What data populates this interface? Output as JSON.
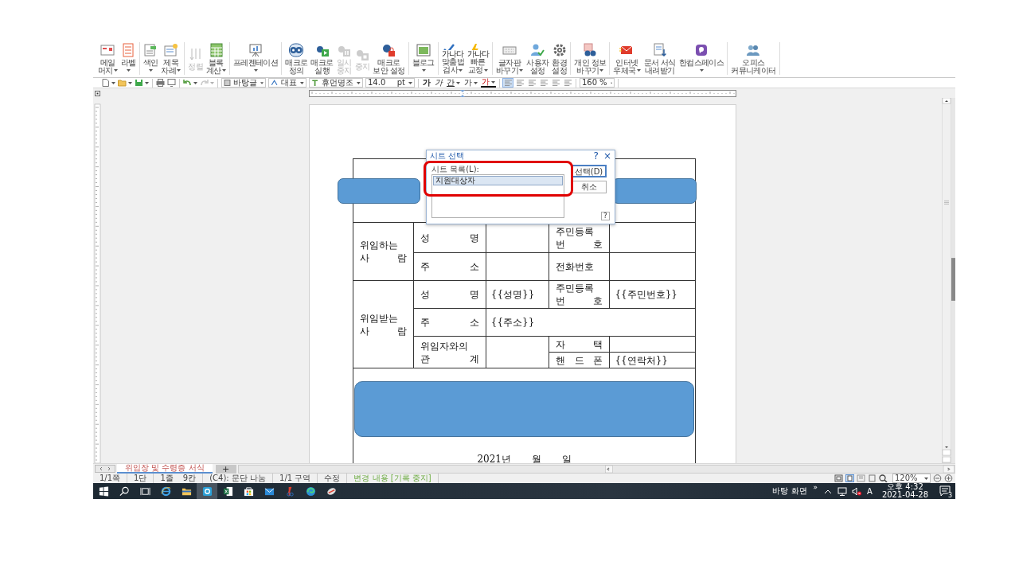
{
  "ribbon": {
    "groups": [
      {
        "buttons": [
          {
            "label": [
              "메일",
              "머지"
            ],
            "dropdown": true,
            "disabled": false
          },
          {
            "label": [
              "라벨"
            ],
            "dropdown": true,
            "disabled": false
          }
        ]
      },
      {
        "buttons": [
          {
            "label": [
              "색인"
            ],
            "dropdown": true,
            "disabled": false
          },
          {
            "label": [
              "제목",
              "차례"
            ],
            "dropdown": true,
            "disabled": false
          }
        ]
      },
      {
        "buttons": [
          {
            "label": [
              "정렬"
            ],
            "dropdown": false,
            "disabled": true
          },
          {
            "label": [
              "블록",
              "계산"
            ],
            "dropdown": true,
            "disabled": false
          }
        ]
      },
      {
        "buttons": [
          {
            "label": [
              "프레젠테이션"
            ],
            "dropdown": true,
            "disabled": false
          }
        ]
      },
      {
        "buttons": [
          {
            "label": [
              "매크로",
              "정의"
            ],
            "dropdown": false,
            "disabled": false
          },
          {
            "label": [
              "매크로",
              "실행"
            ],
            "dropdown": false,
            "disabled": false
          },
          {
            "label": [
              "일시",
              "중지"
            ],
            "dropdown": false,
            "disabled": true
          },
          {
            "label": [
              "중지"
            ],
            "dropdown": false,
            "disabled": true
          },
          {
            "label": [
              "매크로",
              "보안 설정"
            ],
            "dropdown": false,
            "disabled": false
          }
        ]
      },
      {
        "buttons": [
          {
            "label": [
              "블로그"
            ],
            "dropdown": true,
            "disabled": false
          }
        ]
      },
      {
        "buttons": [
          {
            "icon_text": "가나다",
            "label": [
              "맞춤법",
              "검사"
            ],
            "dropdown": true,
            "disabled": false
          },
          {
            "icon_text": "가나다",
            "label": [
              "빠른",
              "교정"
            ],
            "dropdown": true,
            "disabled": false
          }
        ]
      },
      {
        "buttons": [
          {
            "label": [
              "글자판",
              "바꾸기"
            ],
            "dropdown": true,
            "disabled": false
          },
          {
            "label": [
              "사용자",
              "설정"
            ],
            "dropdown": false,
            "disabled": false
          },
          {
            "label": [
              "환경",
              "설정"
            ],
            "dropdown": false,
            "disabled": false
          }
        ]
      },
      {
        "buttons": [
          {
            "label": [
              "개인 정보",
              "바꾸기"
            ],
            "dropdown": true,
            "disabled": false
          }
        ]
      },
      {
        "buttons": [
          {
            "label": [
              "인터넷",
              "우체국"
            ],
            "dropdown": true,
            "disabled": false
          },
          {
            "label": [
              "문서 서식",
              "내려받기"
            ],
            "dropdown": false,
            "disabled": false
          },
          {
            "label": [
              "한컴스페이스"
            ],
            "dropdown": true,
            "disabled": false
          }
        ]
      },
      {
        "buttons": [
          {
            "label": [
              "오피스",
              "커뮤니케이터"
            ],
            "dropdown": false,
            "disabled": false
          }
        ]
      }
    ]
  },
  "toolbar": {
    "groups": [
      [
        {
          "kind": "icon",
          "dropdown": true,
          "disabled": false
        },
        {
          "kind": "icon",
          "dropdown": true,
          "disabled": false
        },
        {
          "kind": "icon",
          "dropdown": true,
          "disabled": false
        }
      ],
      [
        {
          "kind": "icon",
          "dropdown": false,
          "disabled": false
        },
        {
          "kind": "icon",
          "dropdown": false,
          "disabled": false
        }
      ],
      [
        {
          "kind": "icon",
          "dropdown": true,
          "disabled": false
        },
        {
          "kind": "icon",
          "dropdown": true,
          "disabled": true
        }
      ],
      [
        {
          "kind": "combo",
          "value": "바탕글"
        },
        {
          "kind": "combo",
          "value": "대표"
        },
        {
          "kind": "combo",
          "value": "휴먼명조"
        },
        {
          "kind": "spin",
          "value": "14.0",
          "unit": "pt"
        }
      ],
      [
        {
          "kind": "char",
          "text": "가",
          "dropdown": false
        },
        {
          "kind": "char",
          "text": "가",
          "dropdown": false
        },
        {
          "kind": "char",
          "text": "간",
          "dropdown": true
        },
        {
          "kind": "char",
          "text": "가",
          "dropdown": true
        },
        {
          "kind": "char",
          "text": "가",
          "dropdown": true
        }
      ],
      [
        {
          "kind": "align",
          "selected": true
        },
        {
          "kind": "align",
          "selected": false
        },
        {
          "kind": "align",
          "selected": false
        },
        {
          "kind": "align",
          "selected": false
        },
        {
          "kind": "align",
          "selected": false
        },
        {
          "kind": "align",
          "selected": false
        }
      ],
      [
        {
          "kind": "spin",
          "value": "160",
          "unit": "%"
        }
      ]
    ]
  },
  "document": {
    "table": {
      "rows": [
        [
          {
            "colspan": 5
          }
        ],
        [
          {
            "rowspan": 2,
            "kind": "label",
            "lines": [
              "위임하는",
              "사 람"
            ]
          },
          {
            "kind": "label",
            "lines": [
              "성 명"
            ]
          },
          {},
          {
            "kind": "label",
            "lines": [
              "주민등록",
              "번 호"
            ]
          },
          {}
        ],
        [
          {
            "kind": "label",
            "lines": [
              "주 소"
            ]
          },
          {},
          {
            "kind": "label",
            "lines": [
              "전화번호"
            ]
          },
          {}
        ],
        [
          {
            "rowspan": 4,
            "kind": "label",
            "lines": [
              "위임받는",
              "사 람"
            ]
          },
          {
            "kind": "label",
            "lines": [
              "성 명"
            ]
          },
          {
            "kind": "value",
            "lines": [
              "{{성명}}"
            ]
          },
          {
            "kind": "label",
            "lines": [
              "주민등록",
              "번 호"
            ]
          },
          {
            "kind": "value",
            "lines": [
              "{{주민번호}}"
            ]
          }
        ],
        [
          {
            "kind": "label",
            "lines": [
              "주 소"
            ]
          },
          {
            "colspan": 3,
            "kind": "value",
            "lines": [
              "{{주소}}"
            ]
          }
        ],
        [
          {
            "rowspan": 2,
            "kind": "label",
            "lines": [
              "위임자와의",
              "관 계"
            ]
          },
          {
            "rowspan": 2
          },
          {
            "kind": "label",
            "lines": [
              "자 택"
            ]
          },
          {}
        ],
        [
          {
            "kind": "label",
            "lines": [
              "핸 드 폰"
            ]
          },
          {
            "kind": "value",
            "lines": [
              "{{연락처}}"
            ]
          }
        ],
        [
          {
            "colspan": 5,
            "kind": "date",
            "lines": [
              "2021년 월 일"
            ]
          }
        ]
      ]
    }
  },
  "dialog": {
    "title": "시트 선택",
    "help": "?",
    "close": "×",
    "list_label": "시트 목록(L):",
    "items": [
      {
        "text": "지원대상자",
        "selected": true
      }
    ],
    "buttons": [
      {
        "label": "선택(D)",
        "default": true
      },
      {
        "label": "취소",
        "default": false
      }
    ],
    "help_button": "?",
    "highlight": true
  },
  "sheet_tabs": {
    "tabs": [
      {
        "label": "위임장 및 수령증 서식",
        "selected": true
      }
    ],
    "add": "+"
  },
  "status_bar": {
    "segments": [
      {
        "texts": [
          "1/1쪽"
        ],
        "active": false
      },
      {
        "texts": [
          "1단"
        ],
        "active": false
      },
      {
        "texts": [
          "1줄",
          "9칸"
        ],
        "active": false
      },
      {
        "texts": [
          "(C4): 문단 나눔"
        ],
        "active": false
      },
      {
        "texts": [
          "1/1 구역"
        ],
        "active": false
      },
      {
        "texts": [
          "수정"
        ],
        "active": false
      },
      {
        "texts": [
          "변경 내용 [기록 중지]"
        ],
        "active": true
      }
    ],
    "zoom": "120%"
  },
  "taskbar": {
    "apps": [
      {
        "selected": false
      },
      {
        "selected": false
      },
      {
        "selected": false
      },
      {
        "selected": false
      },
      {
        "selected": false
      },
      {
        "selected": true
      },
      {
        "selected": false
      },
      {
        "selected": false
      },
      {
        "selected": false
      },
      {
        "selected": false
      },
      {
        "selected": false
      },
      {
        "selected": false
      }
    ],
    "desktop_label": "바탕 화면",
    "more": "»",
    "ime": "A",
    "time": "오후 4:32",
    "date": "2021-04-28",
    "notifications": "3"
  }
}
